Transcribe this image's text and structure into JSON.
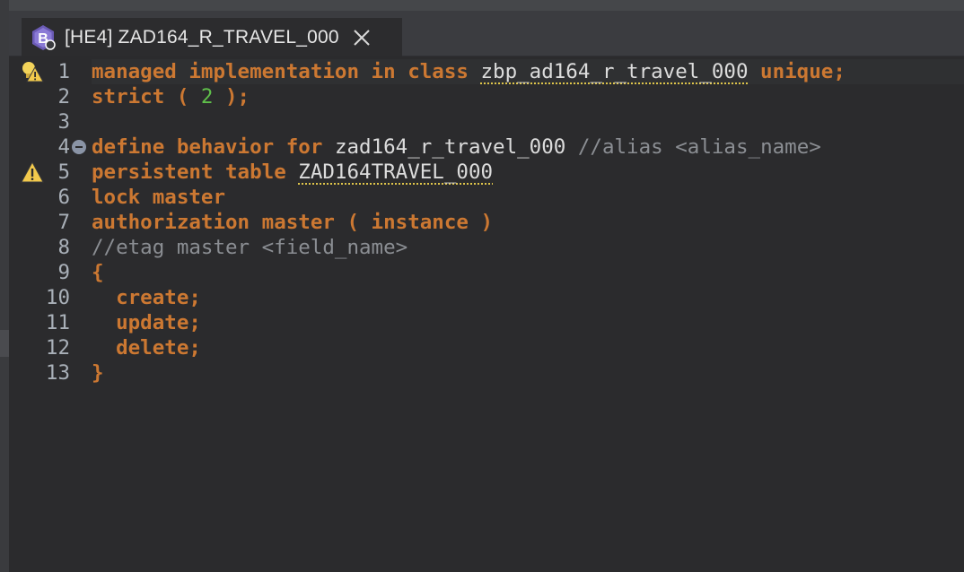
{
  "tab": {
    "title": "[HE4] ZAD164_R_TRAVEL_000",
    "icon": "behavior-definition-icon"
  },
  "colors": {
    "keyword": "#cc7832",
    "identifier": "#dcdcdc",
    "number": "#5fbf4a",
    "comment": "#8b8e93",
    "warning_underline": "#e0c64a",
    "background": "#2b2b2d"
  },
  "lines": [
    {
      "n": "1",
      "parts": [
        {
          "t": "managed implementation in class ",
          "c": "kw"
        },
        {
          "t": "zbp_ad164_r_travel_000",
          "c": "id warn"
        },
        {
          "t": " unique;",
          "c": "kw"
        }
      ]
    },
    {
      "n": "2",
      "parts": [
        {
          "t": "strict ( ",
          "c": "kw"
        },
        {
          "t": "2",
          "c": "num"
        },
        {
          "t": " );",
          "c": "kw"
        }
      ]
    },
    {
      "n": "3",
      "parts": []
    },
    {
      "n": "4",
      "parts": [
        {
          "t": "define behavior for ",
          "c": "kw"
        },
        {
          "t": "zad164_r_travel_000 ",
          "c": "id"
        },
        {
          "t": "//alias <alias_name>",
          "c": "cm"
        }
      ]
    },
    {
      "n": "5",
      "parts": [
        {
          "t": "persistent table ",
          "c": "kw"
        },
        {
          "t": "ZAD164TRAVEL_000",
          "c": "id warn"
        }
      ]
    },
    {
      "n": "6",
      "parts": [
        {
          "t": "lock master",
          "c": "kw"
        }
      ]
    },
    {
      "n": "7",
      "parts": [
        {
          "t": "authorization master ( instance )",
          "c": "kw"
        }
      ]
    },
    {
      "n": "8",
      "parts": [
        {
          "t": "//etag master <field_name>",
          "c": "cm"
        }
      ]
    },
    {
      "n": "9",
      "parts": [
        {
          "t": "{",
          "c": "kw"
        }
      ]
    },
    {
      "n": "10",
      "parts": [
        {
          "t": "  create;",
          "c": "kw"
        }
      ]
    },
    {
      "n": "11",
      "parts": [
        {
          "t": "  update;",
          "c": "kw"
        }
      ]
    },
    {
      "n": "12",
      "parts": [
        {
          "t": "  delete;",
          "c": "kw"
        }
      ]
    },
    {
      "n": "13",
      "parts": [
        {
          "t": "}",
          "c": "kw"
        }
      ]
    }
  ],
  "markers": [
    {
      "line": "1",
      "icon": "lightbulb-warning-icon"
    },
    {
      "line": "4",
      "icon": "fold-collapse-icon"
    },
    {
      "line": "5",
      "icon": "warning-icon"
    }
  ]
}
